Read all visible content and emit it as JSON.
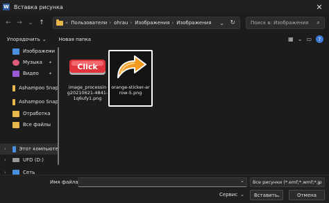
{
  "window": {
    "title": "Вставка рисунка",
    "app_icon": "W"
  },
  "address": {
    "prefix": "«",
    "crumbs": [
      "Пользователи",
      "ohrau",
      "Изображения",
      "Изображения"
    ],
    "search_placeholder": "Поиск в: Изображения"
  },
  "toolbar": {
    "organize": "Упорядочить",
    "new_folder": "Новая папка"
  },
  "sidebar": {
    "items": [
      {
        "label": "Изображени",
        "icon": "pictures-icon",
        "color": "#4a8fe0",
        "pinned": true
      },
      {
        "label": "Музыка",
        "icon": "music-icon",
        "color": "#e05a7a",
        "pinned": true
      },
      {
        "label": "Видео",
        "icon": "video-icon",
        "color": "#9b5ad6",
        "pinned": true
      },
      {
        "label": "Ashampoo Snap",
        "icon": "folder-icon",
        "color": "#e8b84a",
        "pinned": false
      },
      {
        "label": "Ashampoo Snap",
        "icon": "folder-icon",
        "color": "#e8b84a",
        "pinned": false
      },
      {
        "label": "Отработка",
        "icon": "folder-icon",
        "color": "#e8b84a",
        "pinned": false
      },
      {
        "label": "Все файлы",
        "icon": "folder-icon",
        "color": "#e8b84a",
        "pinned": false
      },
      {
        "label": "Этот компьюте",
        "icon": "computer-icon",
        "color": "#4a8fe0",
        "pinned": false
      },
      {
        "label": "UFD (D:)",
        "icon": "drive-icon",
        "color": "#9a9a9a",
        "pinned": false
      },
      {
        "label": "Сеть",
        "icon": "network-icon",
        "color": "#4a8fe0",
        "pinned": false
      }
    ]
  },
  "files": [
    {
      "name_lines": [
        "image_processin",
        "g20210621-4841-",
        "1q6ufy1.png"
      ],
      "thumb_text": "Click",
      "selected": false
    },
    {
      "name_lines": [
        "orange-sticker-ar",
        "row-5.png"
      ],
      "thumb_text": "",
      "selected": true
    }
  ],
  "bottom": {
    "filename_label": "Имя файла:",
    "filename_value": "",
    "filetype_value": "Все рисунки (*.emf;*.wmf;*.jp",
    "service_label": "Сервис",
    "insert_label": "Вставить",
    "cancel_label": "Отмена"
  },
  "colors": {
    "accent": "#3d7bd6",
    "folder": "#e8b84a",
    "click_red": "#e0353d",
    "arrow_orange": "#f39a21"
  }
}
